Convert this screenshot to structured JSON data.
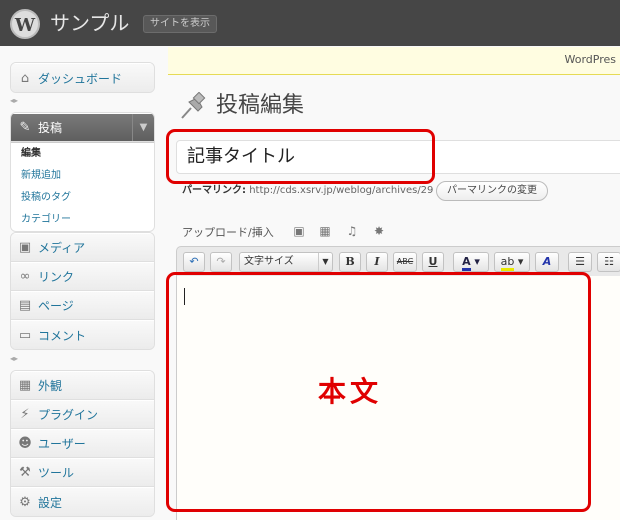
{
  "header": {
    "logo_glyph": "W",
    "site_name": "サンプル",
    "view_site": "サイトを表示"
  },
  "update_nag": "WordPres",
  "sidebar": {
    "dashboard": "ダッシュボード",
    "posts": {
      "label": "投稿",
      "submenu": [
        "編集",
        "新規追加",
        "投稿のタグ",
        "カテゴリー"
      ]
    },
    "group2": [
      "メディア",
      "リンク",
      "ページ",
      "コメント"
    ],
    "group3": [
      "外観",
      "プラグイン",
      "ユーザー",
      "ツール",
      "設定"
    ]
  },
  "page": {
    "title": "投稿編集",
    "post_title_value": "記事タイトル",
    "permalink_label": "パーマリンク:",
    "permalink_url": "http://cds.xsrv.jp/weblog/archives/29",
    "permalink_button": "パーマリンクの変更",
    "upload_label": "アップロード/挿入"
  },
  "toolbar": {
    "format_select": "文字サイズ"
  },
  "annotations": {
    "body_label": "本文"
  },
  "colors": {
    "header_bg": "#464646",
    "link": "#21759b",
    "annotation_red": "#e00000",
    "nag_bg": "#fffde1"
  }
}
